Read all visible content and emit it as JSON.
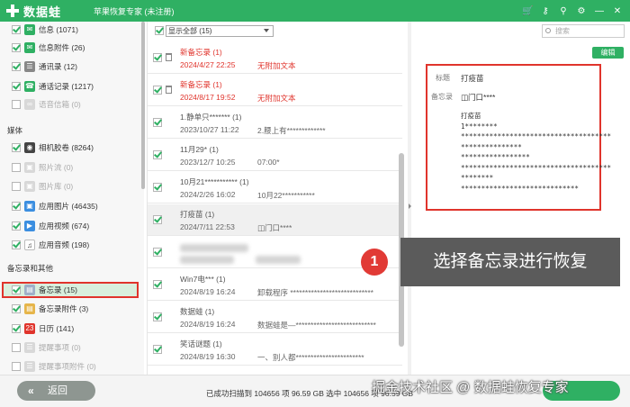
{
  "app": {
    "logo_text": "数据蛙",
    "title": "苹果恢复专家 (未注册)"
  },
  "titlebar_icons": [
    "cart-icon",
    "key-icon",
    "location-icon",
    "settings-icon",
    "minimize-icon",
    "close-icon"
  ],
  "titlebar_glyphs": [
    "🛒",
    "⚷",
    "⚲",
    "⚙",
    "—",
    "✕"
  ],
  "sidebar": {
    "messages": [
      {
        "label": "信息 (1071)",
        "checked": true,
        "dim": false,
        "icon": "message-icon",
        "color": "#2fb063",
        "glyph": "✉"
      },
      {
        "label": "信息附件 (26)",
        "checked": true,
        "dim": false,
        "icon": "attachment-icon",
        "color": "#2fb063",
        "glyph": "✉"
      },
      {
        "label": "通讯录 (12)",
        "checked": true,
        "dim": false,
        "icon": "contacts-icon",
        "color": "#888888",
        "glyph": "☰"
      },
      {
        "label": "通话记录 (1217)",
        "checked": true,
        "dim": false,
        "icon": "call-log-icon",
        "color": "#2fb063",
        "glyph": "☎"
      },
      {
        "label": "语音信箱 (0)",
        "checked": false,
        "dim": true,
        "icon": "voicemail-icon",
        "color": "#cccccc",
        "glyph": "∞"
      }
    ],
    "media_heading": "媒体",
    "media": [
      {
        "label": "相机胶卷 (8264)",
        "checked": true,
        "dim": false,
        "icon": "camera-icon",
        "color": "#444444",
        "glyph": "◉"
      },
      {
        "label": "照片流 (0)",
        "checked": false,
        "dim": true,
        "icon": "photo-stream-icon",
        "color": "#cccccc",
        "glyph": "▣"
      },
      {
        "label": "图片库 (0)",
        "checked": false,
        "dim": true,
        "icon": "photo-library-icon",
        "color": "#cccccc",
        "glyph": "▣"
      },
      {
        "label": "应用图片 (46435)",
        "checked": true,
        "dim": false,
        "icon": "app-photo-icon",
        "color": "#3b8ee0",
        "glyph": "▣"
      },
      {
        "label": "应用视频 (674)",
        "checked": true,
        "dim": false,
        "icon": "app-video-icon",
        "color": "#3b8ee0",
        "glyph": "▶"
      },
      {
        "label": "应用音频 (198)",
        "checked": true,
        "dim": false,
        "icon": "app-audio-icon",
        "color": "#ffffff",
        "glyph": "♫"
      }
    ],
    "memo_heading": "备忘录和其他",
    "memo": [
      {
        "label": "备忘录 (15)",
        "checked": true,
        "dim": false,
        "icon": "notes-icon",
        "color": "#9fb0c8",
        "glyph": "▤",
        "selected": true
      },
      {
        "label": "备忘录附件 (3)",
        "checked": true,
        "dim": false,
        "icon": "notes-attachment-icon",
        "color": "#e6b54a",
        "glyph": "▤"
      },
      {
        "label": "日历 (141)",
        "checked": true,
        "dim": false,
        "icon": "calendar-icon",
        "color": "#e0342c",
        "glyph": "23"
      },
      {
        "label": "提醒事项 (0)",
        "checked": false,
        "dim": true,
        "icon": "reminders-icon",
        "color": "#cccccc",
        "glyph": "☰"
      },
      {
        "label": "提醒事项附件 (0)",
        "checked": false,
        "dim": true,
        "icon": "reminders-attachment-icon",
        "color": "#cccccc",
        "glyph": "☰"
      }
    ]
  },
  "list": {
    "filter_value": "显示全部 (15)",
    "items": [
      {
        "title": "新备忘录 (1)",
        "date": "2024/4/27 22:25",
        "preview": "无附加文本",
        "deleted": true,
        "blurred": false
      },
      {
        "title": "新备忘录 (1)",
        "date": "2024/8/17 19:52",
        "preview": "无附加文本",
        "deleted": true,
        "blurred": false
      },
      {
        "title": "1.静单只******* (1)",
        "date": "2023/10/27 11:22",
        "preview": "2.腰上有*************",
        "deleted": false,
        "blurred": false
      },
      {
        "title": "11月29* (1)",
        "date": "2023/12/7 10:25",
        "preview": "07:00*",
        "deleted": false,
        "blurred": false
      },
      {
        "title": "10月21*********** (1)",
        "date": "2024/2/26 16:02",
        "preview": "10月22***********",
        "deleted": false,
        "blurred": false
      },
      {
        "title": "打疫苗 (1)",
        "date": "2024/7/11 22:53",
        "preview": "◫门口****",
        "deleted": false,
        "blurred": false,
        "selected": true
      },
      {
        "title": "",
        "date": "",
        "preview": "",
        "deleted": false,
        "blurred": true
      },
      {
        "title": "Win7电*** (1)",
        "date": "2024/8/19 16:24",
        "preview": "卸载程序 ****************************",
        "deleted": false,
        "blurred": false
      },
      {
        "title": "数据蛙 (1)",
        "date": "2024/8/19 16:24",
        "preview": "数据蛙是—***************************",
        "deleted": false,
        "blurred": false
      },
      {
        "title": "笑话谜题 (1)",
        "date": "2024/8/19 16:30",
        "preview": "一、别人都***********************",
        "deleted": false,
        "blurred": false
      }
    ]
  },
  "callout": {
    "number": "1",
    "text": "选择备忘录进行恢复"
  },
  "detail": {
    "search_placeholder": "搜索",
    "edit_label": "编辑",
    "title_label": "标题",
    "title_value": "打疫苗",
    "memo_label": "备忘录",
    "memo_value": "◫门口****",
    "content": "打疫苗\n1********\n*************************************\n***************\n*****************\n*************************************\n********\n*****************************"
  },
  "bottom": {
    "back_label": "返回",
    "status": "已成功扫描到 104656 项 96.59 GB  选中 104656 项 96.59 GB"
  },
  "watermark": "掘金技术社区 @ 数据蛙恢复专家"
}
